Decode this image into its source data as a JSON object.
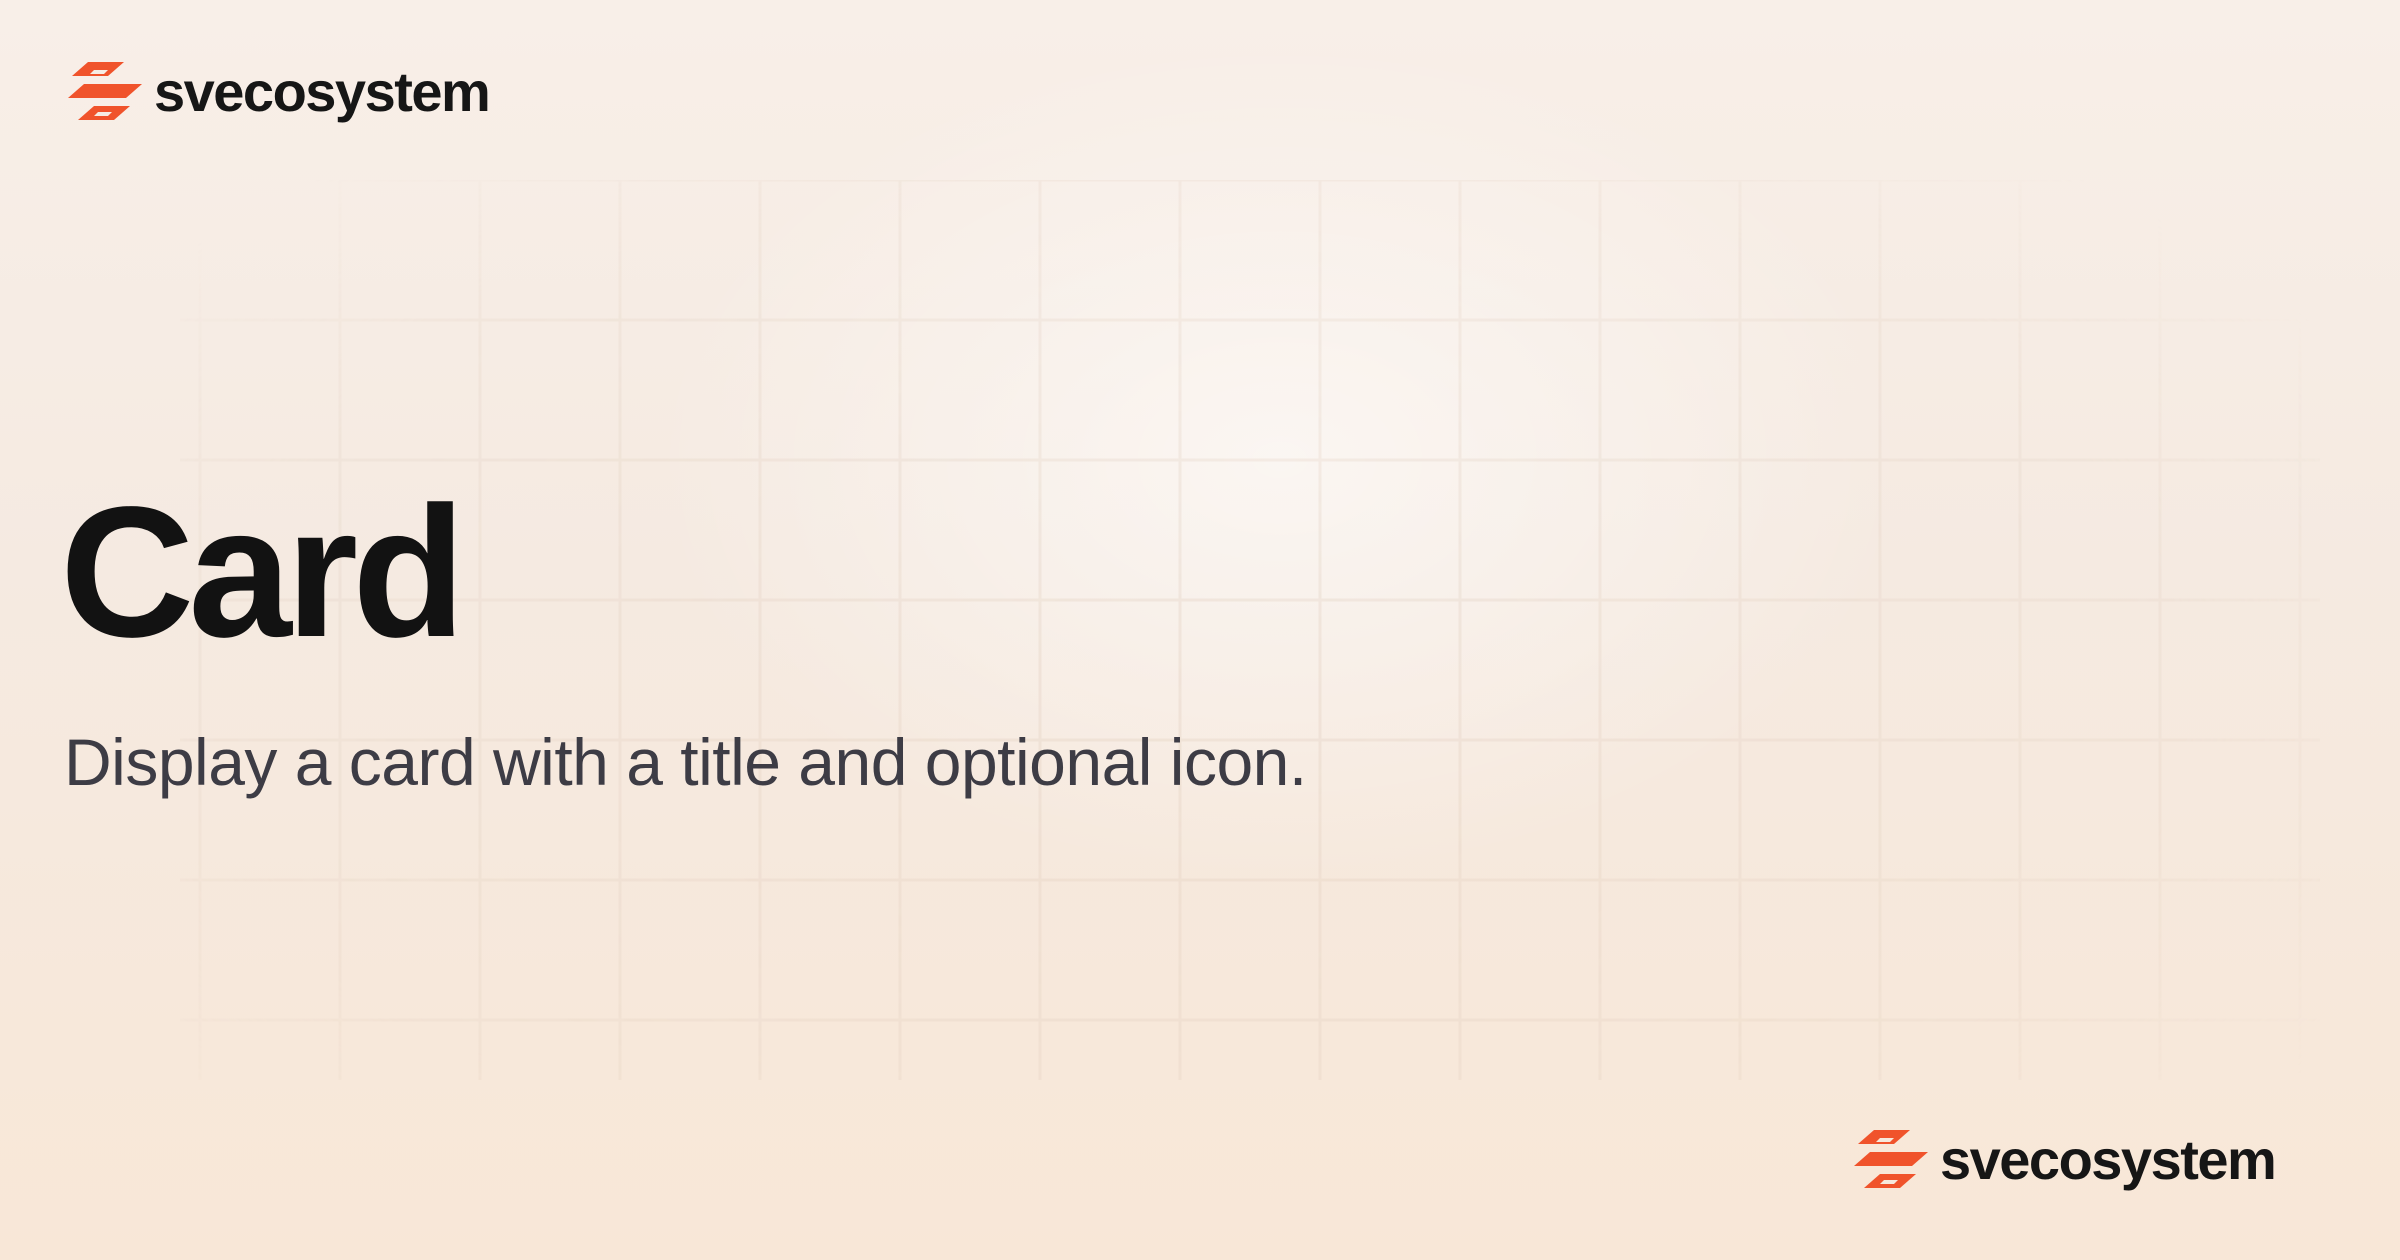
{
  "brand": {
    "name": "svecosystem",
    "accent_color": "#f0532b",
    "logo_icon": "svecosystem-logo-icon"
  },
  "page": {
    "title": "Card",
    "description": "Display a card with a title and optional icon."
  },
  "colors": {
    "background": "#f6ece3",
    "title": "#121212",
    "description": "#3d3c45"
  }
}
